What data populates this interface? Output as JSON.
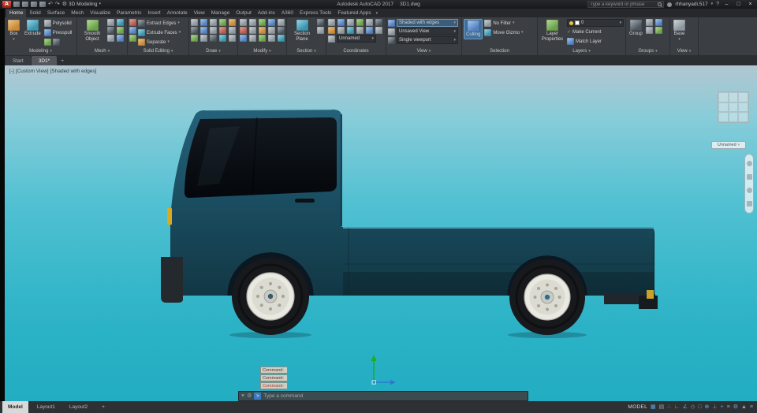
{
  "glyphs": {
    "caret": "▾",
    "close": "×",
    "minimize": "–",
    "maximize": "□",
    "plus": "+",
    "gear": "⚙",
    "check": "✓",
    "question": "?",
    "undo": "↶",
    "redo": "↷",
    "prompt": ">"
  },
  "colors": {
    "viewport_top": "#b2c7d1",
    "viewport_bottom": "#22adc2",
    "truck_body": "#1b4f63",
    "ribbon_bg": "#3b3e42",
    "highlight_blue": "#3f6f9d"
  },
  "titlebar": {
    "logo": "A",
    "workspace": "3D Modeling",
    "app_name": "Autodesk AutoCAD 2017",
    "doc_name": "3D1.dwg",
    "search_placeholder": "Type a keyword or phrase",
    "user": "rhhanyadi.517"
  },
  "ribbon": {
    "tabs": [
      {
        "label": "Home",
        "active": true
      },
      {
        "label": "Solid"
      },
      {
        "label": "Surface"
      },
      {
        "label": "Mesh"
      },
      {
        "label": "Visualize"
      },
      {
        "label": "Parametric"
      },
      {
        "label": "Insert"
      },
      {
        "label": "Annotate"
      },
      {
        "label": "View"
      },
      {
        "label": "Manage"
      },
      {
        "label": "Output"
      },
      {
        "label": "Add-ins"
      },
      {
        "label": "A360"
      },
      {
        "label": "Express Tools"
      },
      {
        "label": "Featured Apps"
      }
    ],
    "panels": {
      "modeling": {
        "label": "Modeling",
        "box": "Box",
        "extrude": "Extrude",
        "polysolid": "Polysolid",
        "presspull": "Presspull"
      },
      "mesh": {
        "label": "Mesh",
        "smooth_object": "Smooth Object"
      },
      "solid_editing": {
        "label": "Solid Editing",
        "extract_edges": "Extract Edges",
        "extrude_faces": "Extrude Faces",
        "separate": "Separate"
      },
      "draw": {
        "label": "Draw"
      },
      "modify": {
        "label": "Modify"
      },
      "section": {
        "label": "Section",
        "section_plane": "Section Plane"
      },
      "coordinates": {
        "label": "Coordinates",
        "ucs": "Unnamed"
      },
      "view": {
        "label": "View",
        "visual_style": "Shaded with edges",
        "named_view": "Unsaved View",
        "viewport_config": "Single viewport"
      },
      "selection": {
        "label": "Selection",
        "culling": "Culling",
        "filter": "No Filter",
        "gizmo": "Move Gizmo"
      },
      "layers": {
        "label": "Layers",
        "layer_properties": "Layer Properties",
        "current_layer": "0",
        "make_current": "Make Current",
        "match_layer": "Match Layer"
      },
      "groups": {
        "label": "Groups",
        "group": "Group"
      },
      "view_output": {
        "label": "View",
        "base": "Base"
      }
    }
  },
  "file_tabs": {
    "start": "Start",
    "drawing": "3D1*",
    "new_tab": "+"
  },
  "viewport": {
    "label_controls": "[-]",
    "label_view": "[Custom View]",
    "label_style": "[Shaded with edges]",
    "viewcube_ucs": "Unnamed"
  },
  "command": {
    "history": [
      "Command:",
      "Command:",
      "Command:"
    ],
    "placeholder": "Type a command"
  },
  "layout_tabs": {
    "model": "Model",
    "layout1": "Layout1",
    "layout2": "Layout2",
    "add": "+"
  },
  "statusbar": {
    "model_label": "MODEL",
    "icons": [
      {
        "name": "grid",
        "glyph": "▦",
        "active": true
      },
      {
        "name": "snap-mode",
        "glyph": "▤",
        "active": false
      },
      {
        "name": "infer-constraints",
        "glyph": "∴",
        "active": false
      },
      {
        "name": "ortho-mode",
        "glyph": "∟",
        "active": false
      },
      {
        "name": "polar-tracking",
        "glyph": "∠",
        "active": true
      },
      {
        "name": "isodraft",
        "glyph": "◇",
        "active": false
      },
      {
        "name": "object-snap",
        "glyph": "□",
        "active": true
      },
      {
        "name": "object-snap-tracking",
        "glyph": "⊕",
        "active": true
      },
      {
        "name": "dynamic-ucs",
        "glyph": "⊥",
        "active": false
      },
      {
        "name": "dynamic-input",
        "glyph": "+",
        "active": true
      },
      {
        "name": "lineweight",
        "glyph": "≡",
        "active": false
      },
      {
        "name": "workspace-switching",
        "glyph": "⚙",
        "active": true
      },
      {
        "name": "annotation-scale",
        "glyph": "▲",
        "active": false
      },
      {
        "name": "customization",
        "glyph": "≡",
        "active": true
      }
    ]
  }
}
